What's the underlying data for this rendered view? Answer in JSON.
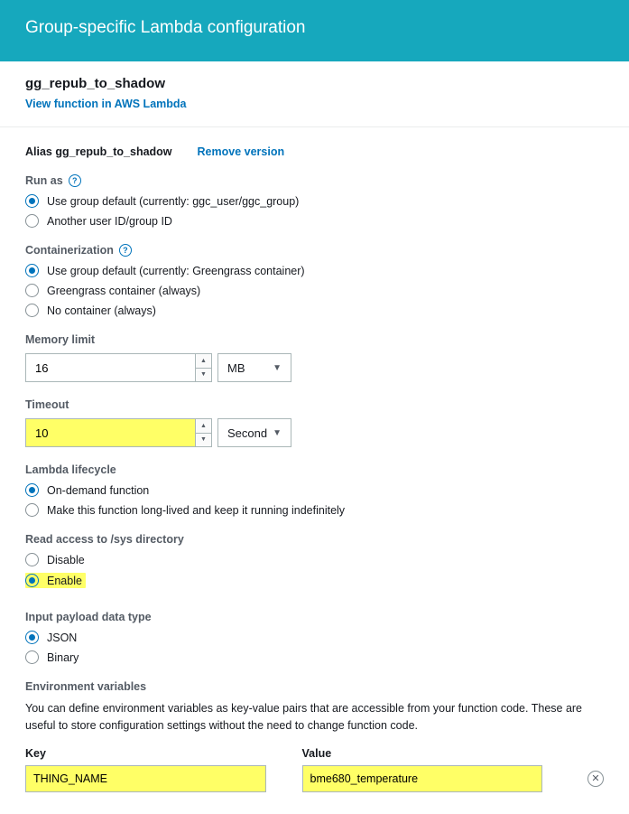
{
  "header": {
    "title": "Group-specific Lambda configuration"
  },
  "fn": {
    "name": "gg_repub_to_shadow",
    "view_link": "View function in AWS Lambda"
  },
  "alias": {
    "text": "Alias gg_repub_to_shadow",
    "remove": "Remove version"
  },
  "run_as": {
    "label": "Run as",
    "opts": [
      "Use group default (currently: ggc_user/ggc_group)",
      "Another user ID/group ID"
    ]
  },
  "containerization": {
    "label": "Containerization",
    "opts": [
      "Use group default (currently: Greengrass container)",
      "Greengrass container (always)",
      "No container (always)"
    ]
  },
  "memory": {
    "label": "Memory limit",
    "value": "16",
    "unit": "MB"
  },
  "timeout": {
    "label": "Timeout",
    "value": "10",
    "unit": "Second"
  },
  "lifecycle": {
    "label": "Lambda lifecycle",
    "opts": [
      "On-demand function",
      "Make this function long-lived and keep it running indefinitely"
    ]
  },
  "sys": {
    "label": "Read access to /sys directory",
    "opts": [
      "Disable",
      "Enable"
    ]
  },
  "payload": {
    "label": "Input payload data type",
    "opts": [
      "JSON",
      "Binary"
    ]
  },
  "env": {
    "label": "Environment variables",
    "desc": "You can define environment variables as key-value pairs that are accessible from your function code. These are useful to store configuration settings without the need to change function code.",
    "key_label": "Key",
    "value_label": "Value",
    "key": "THING_NAME",
    "value": "bme680_temperature"
  }
}
